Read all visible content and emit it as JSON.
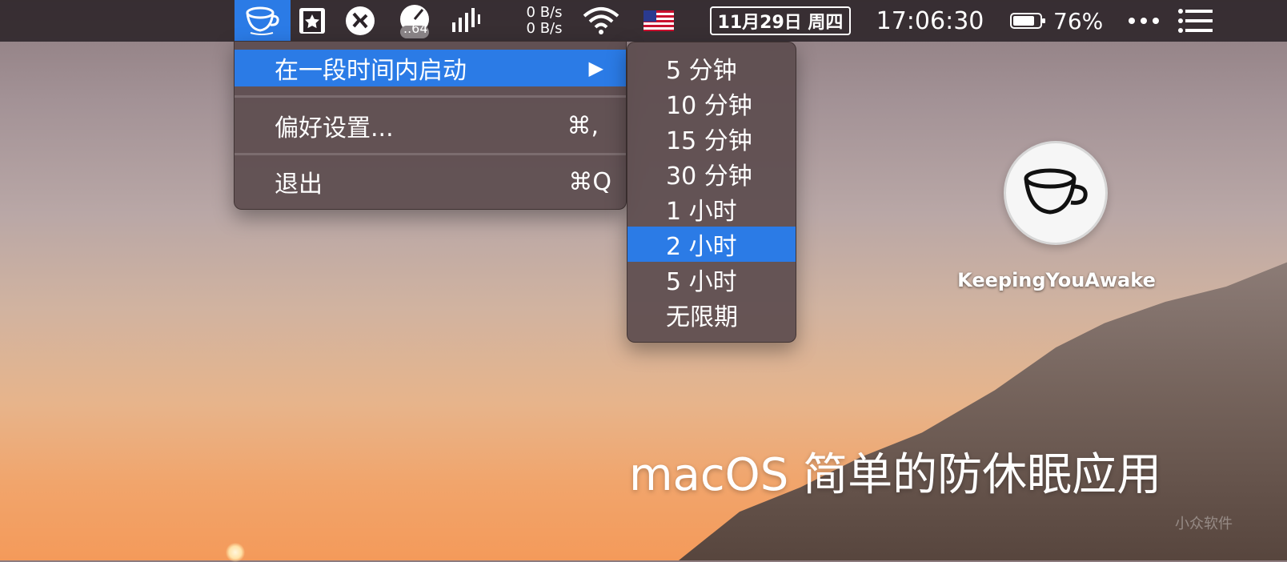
{
  "menubar": {
    "network": {
      "up": "0 B/s",
      "down": "0 B/s"
    },
    "badge": "..64",
    "date": "11月29日 周四",
    "time": "17:06:30",
    "battery": "76%",
    "icons": [
      "cup-icon",
      "bookmark-star-icon",
      "remote-desktop-icon",
      "speed-gauge-icon",
      "signal-bars-icon",
      "wifi-icon",
      "us-flag-icon",
      "battery-icon",
      "more-dots-icon",
      "list-icon"
    ]
  },
  "main_menu": {
    "items": [
      {
        "label": "在一段时间内启动",
        "arrow": "▶"
      },
      {
        "label": "偏好设置...",
        "shortcut": "⌘,"
      },
      {
        "label": "退出",
        "shortcut": "⌘Q"
      }
    ]
  },
  "submenu": {
    "items": [
      "5 分钟",
      "10 分钟",
      "15 分钟",
      "30 分钟",
      "1 小时",
      "2 小时",
      "5 小时",
      "无限期"
    ],
    "selected_index": 5
  },
  "app": {
    "name": "KeepingYouAwake"
  },
  "tagline": "macOS 简单的防休眠应用",
  "watermark": "小众软件",
  "colors": {
    "accent": "#2b7be6",
    "menubar": "#2b2328"
  }
}
